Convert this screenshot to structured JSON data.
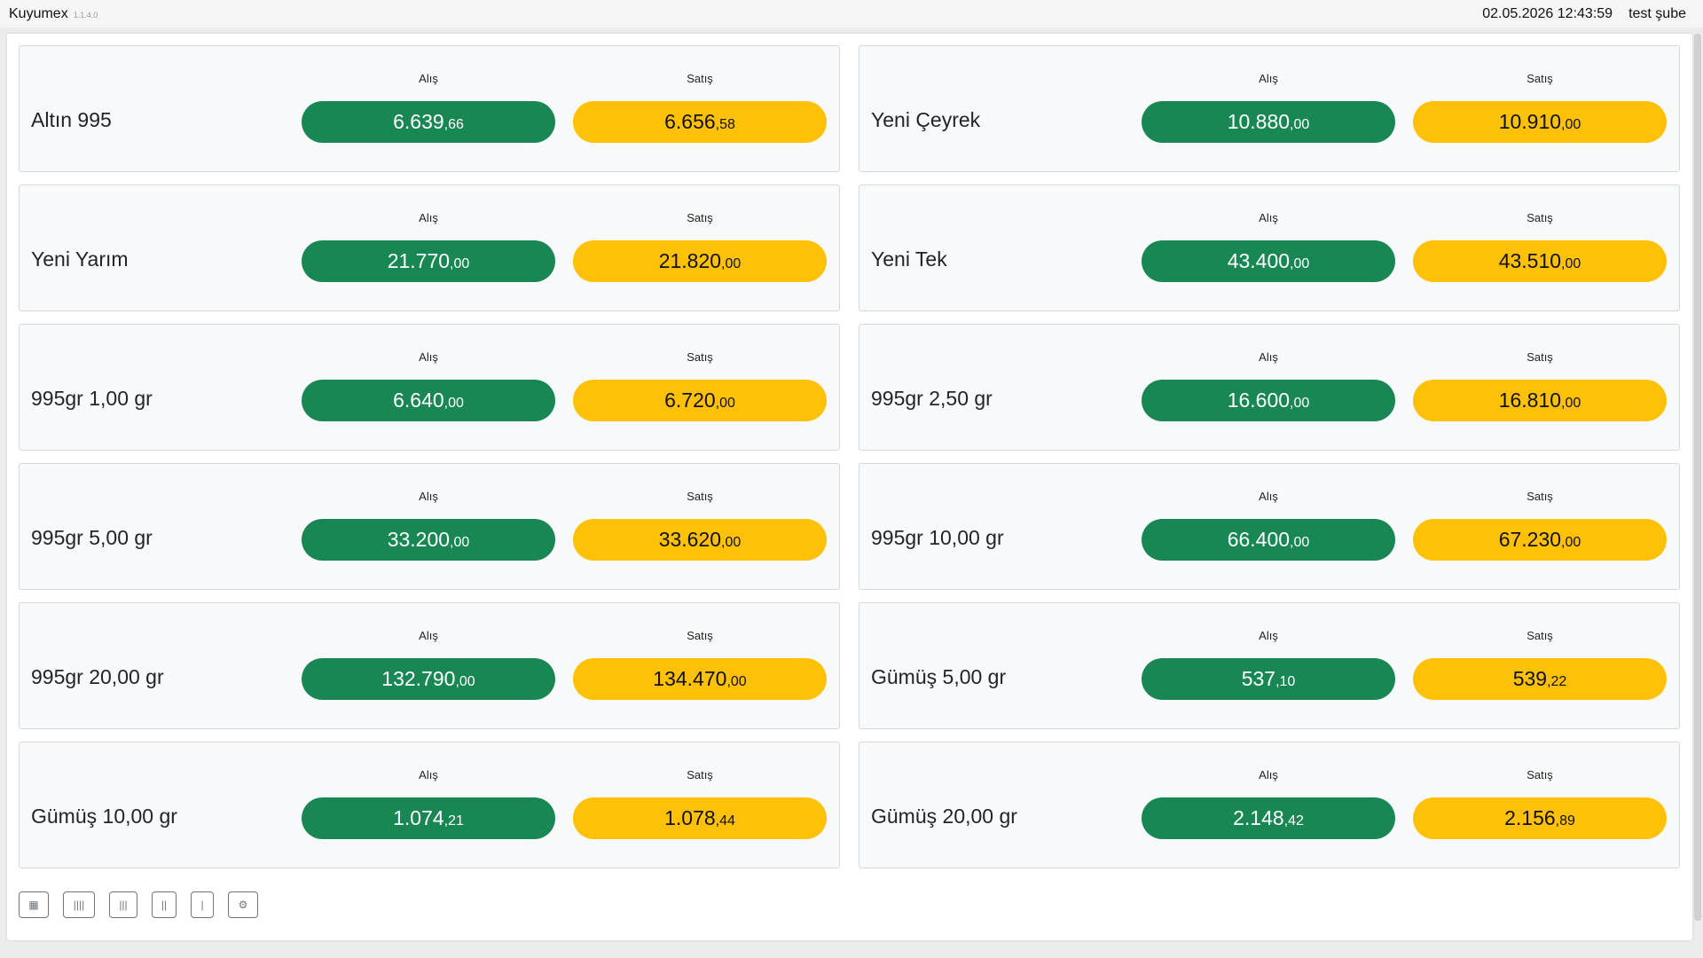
{
  "header": {
    "app_title": "Kuyumex",
    "version": "1.1.4.0",
    "datetime": "02.05.2026 12:43:59",
    "branch": "test şube"
  },
  "labels": {
    "buy": "Alış",
    "sell": "Satış"
  },
  "colors": {
    "buy": "#198754",
    "sell": "#ffc107"
  },
  "products": [
    {
      "name": "Altın 995",
      "buy_int": "6.639",
      "buy_dec": ",66",
      "sell_int": "6.656",
      "sell_dec": ",58"
    },
    {
      "name": "Yeni Çeyrek",
      "buy_int": "10.880",
      "buy_dec": ",00",
      "sell_int": "10.910",
      "sell_dec": ",00"
    },
    {
      "name": "Yeni Yarım",
      "buy_int": "21.770",
      "buy_dec": ",00",
      "sell_int": "21.820",
      "sell_dec": ",00"
    },
    {
      "name": "Yeni Tek",
      "buy_int": "43.400",
      "buy_dec": ",00",
      "sell_int": "43.510",
      "sell_dec": ",00"
    },
    {
      "name": "995gr 1,00 gr",
      "buy_int": "6.640",
      "buy_dec": ",00",
      "sell_int": "6.720",
      "sell_dec": ",00"
    },
    {
      "name": "995gr 2,50 gr",
      "buy_int": "16.600",
      "buy_dec": ",00",
      "sell_int": "16.810",
      "sell_dec": ",00"
    },
    {
      "name": "995gr 5,00 gr",
      "buy_int": "33.200",
      "buy_dec": ",00",
      "sell_int": "33.620",
      "sell_dec": ",00"
    },
    {
      "name": "995gr 10,00 gr",
      "buy_int": "66.400",
      "buy_dec": ",00",
      "sell_int": "67.230",
      "sell_dec": ",00"
    },
    {
      "name": "995gr 20,00 gr",
      "buy_int": "132.790",
      "buy_dec": ",00",
      "sell_int": "134.470",
      "sell_dec": ",00"
    },
    {
      "name": "Gümüş 5,00 gr",
      "buy_int": "537",
      "buy_dec": ",10",
      "sell_int": "539",
      "sell_dec": ",22"
    },
    {
      "name": "Gümüş 10,00 gr",
      "buy_int": "1.074",
      "buy_dec": ",21",
      "sell_int": "1.078",
      "sell_dec": ",44"
    },
    {
      "name": "Gümüş 20,00 gr",
      "buy_int": "2.148",
      "buy_dec": ",42",
      "sell_int": "2.156",
      "sell_dec": ",89"
    }
  ],
  "toolbar": [
    {
      "icon": "grid-4-icon",
      "glyph": "▦"
    },
    {
      "icon": "columns-4-icon",
      "glyph": "||||"
    },
    {
      "icon": "columns-3-icon",
      "glyph": "|||"
    },
    {
      "icon": "columns-2-icon",
      "glyph": "||"
    },
    {
      "icon": "columns-1-icon",
      "glyph": "|"
    },
    {
      "icon": "gear-icon",
      "glyph": "⚙"
    }
  ]
}
